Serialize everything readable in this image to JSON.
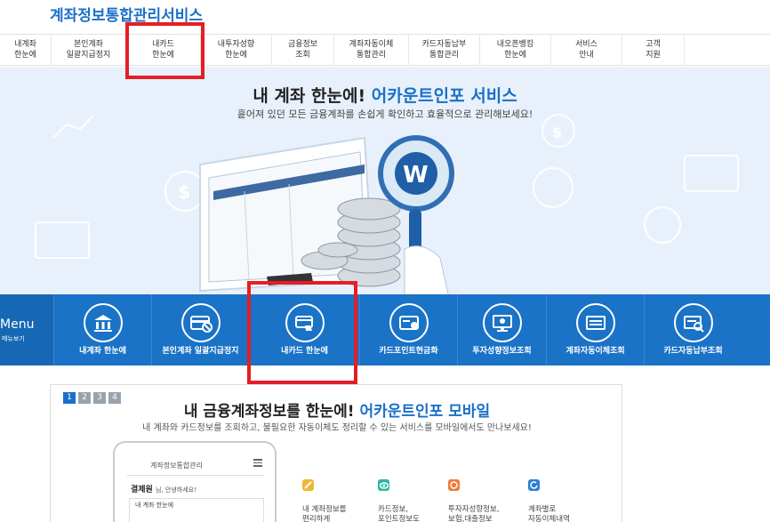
{
  "header": {
    "logo": "계좌정보통합관리서비스"
  },
  "nav": {
    "items": [
      {
        "label": "내계좌\n한눈에"
      },
      {
        "label": "본인계좌\n일괄지급정지"
      },
      {
        "label": "내카드\n한눈에"
      },
      {
        "label": "내투자성향\n한눈에"
      },
      {
        "label": "금융정보\n조회"
      },
      {
        "label": "계좌자동이체\n통합관리"
      },
      {
        "label": "카드자동납부\n통합관리"
      },
      {
        "label": "내오픈뱅킹\n한눈에"
      },
      {
        "label": "서비스\n안내"
      },
      {
        "label": "고객\n지원"
      }
    ]
  },
  "hero": {
    "title_a": "내 계좌 한눈에!",
    "title_b": "어카운트인포 서비스",
    "subtitle": "흩어져 있던 모든 금융계좌를 손쉽게 확인하고 효율적으로 관리해보세요!"
  },
  "menu": {
    "label": "Menu",
    "sublabel": "메뉴보기",
    "items": [
      {
        "label": "내계좌 한눈에",
        "icon": "bank-icon"
      },
      {
        "label": "본인계좌 일괄지급정지",
        "icon": "card-stop-icon"
      },
      {
        "label": "내카드 한눈에",
        "icon": "card-hand-icon"
      },
      {
        "label": "카드포인트현금화",
        "icon": "card-point-icon"
      },
      {
        "label": "투자성향정보조회",
        "icon": "monitor-icon"
      },
      {
        "label": "계좌자동이체조회",
        "icon": "transfer-icon"
      },
      {
        "label": "카드자동납부조회",
        "icon": "card-search-icon"
      }
    ]
  },
  "promo": {
    "pages": [
      "1",
      "2",
      "3",
      "4"
    ],
    "title_a": "내 금융계좌정보를 한눈에!",
    "title_b": "어카운트인포 모바일",
    "subtitle": "내 계좌와 카드정보를 조회하고, 불필요한 자동이체도 정리할 수 있는 서비스를 모바일에서도 만나보세요!",
    "phone": {
      "title": "계좌정보통합관리",
      "user": "결제원",
      "greeting": "님, 안녕하세요!",
      "box": "내 계좌 한눈에"
    },
    "features": [
      {
        "text": "내 계좌정보를\n편리하게\n관리",
        "color": "#f1b733"
      },
      {
        "text": "카드정보,\n포인트정보도\n한눈에!",
        "color": "#2fb5a4"
      },
      {
        "text": "투자자성향정보,\n보험,대출정보\n한눈에 확인",
        "color": "#f27b3a"
      },
      {
        "text": "계좌별로\n자동이체내역\n확인",
        "color": "#2f7fd3"
      }
    ]
  }
}
